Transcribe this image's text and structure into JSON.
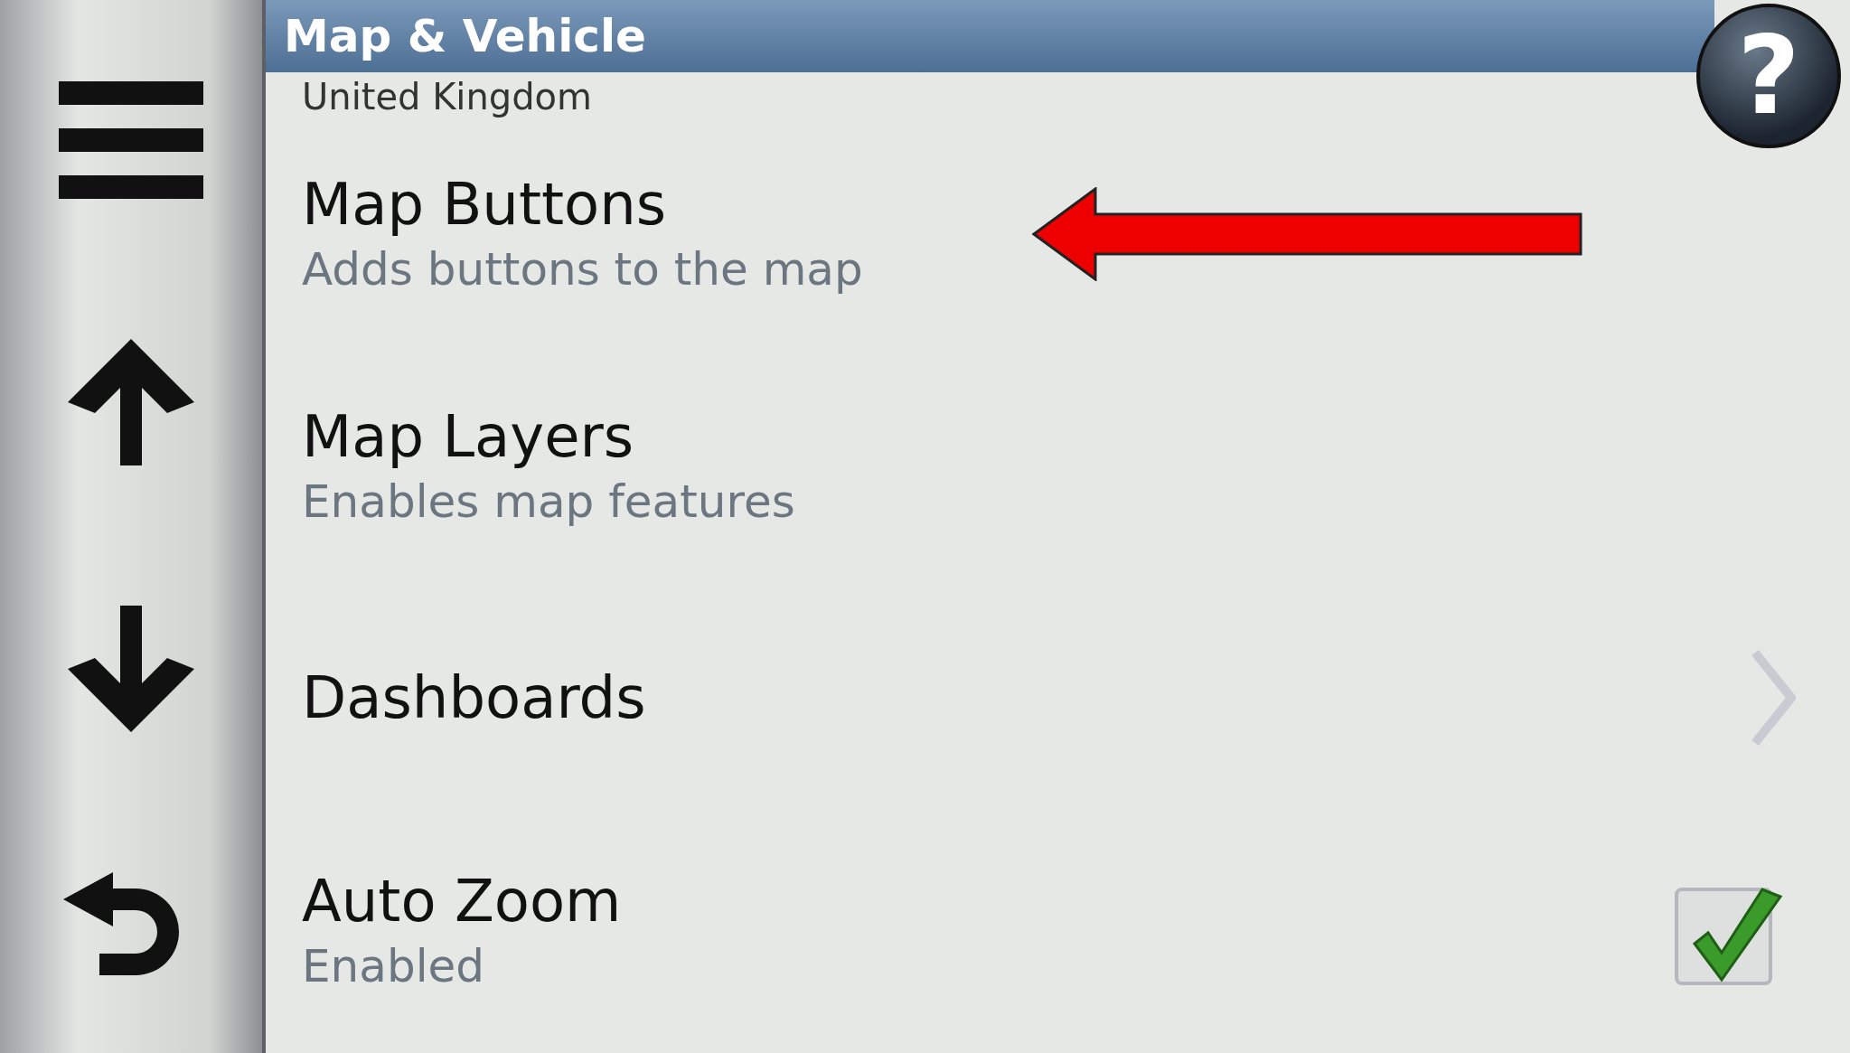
{
  "header": {
    "title": "Map & Vehicle",
    "help_label": "?"
  },
  "scrolled_subtitle": "United Kingdom",
  "items": [
    {
      "title": "Map Buttons",
      "subtitle": "Adds buttons to the map",
      "kind": "plain"
    },
    {
      "title": "Map Layers",
      "subtitle": "Enables map features",
      "kind": "plain"
    },
    {
      "title": "Dashboards",
      "kind": "submenu"
    },
    {
      "title": "Auto Zoom",
      "subtitle": "Enabled",
      "kind": "checkbox",
      "checked": true
    }
  ]
}
